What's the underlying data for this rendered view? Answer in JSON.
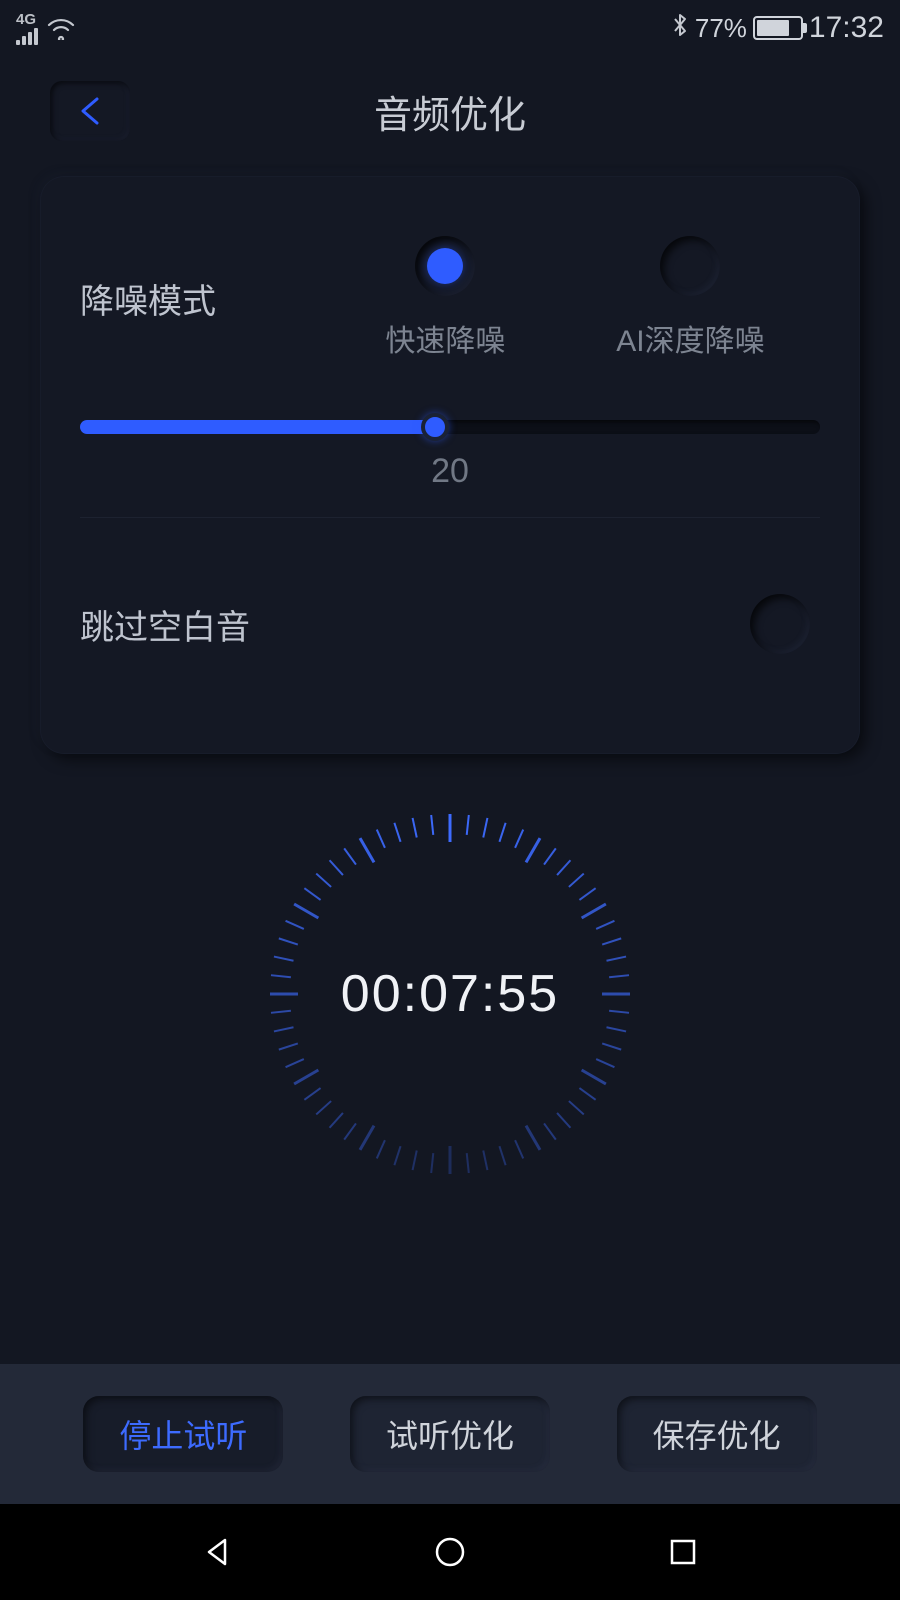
{
  "status": {
    "network": "4G",
    "battery_pct": "77%",
    "time": "17:32",
    "bluetooth_icon": "bluetooth"
  },
  "header": {
    "title": "音频优化"
  },
  "panel": {
    "noise_mode_label": "降噪模式",
    "options": [
      {
        "label": "快速降噪",
        "selected": true
      },
      {
        "label": "AI深度降噪",
        "selected": false
      }
    ],
    "slider_value": "20",
    "skip_silence_label": "跳过空白音",
    "skip_silence_enabled": false
  },
  "timer": {
    "value": "00:07:55"
  },
  "actions": {
    "stop_preview": "停止试听",
    "preview_optimize": "试听优化",
    "save_optimize": "保存优化"
  }
}
